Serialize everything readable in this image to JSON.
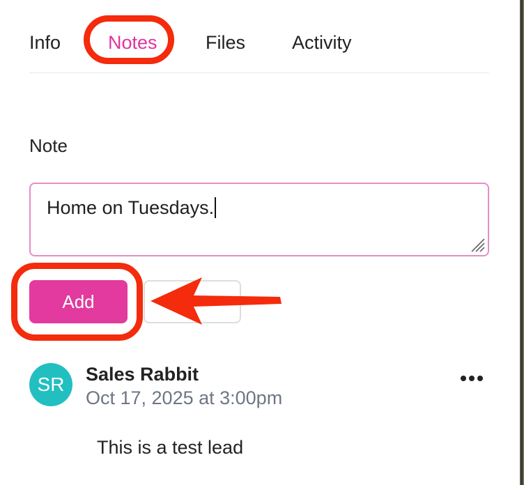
{
  "tabs": [
    {
      "label": "Info"
    },
    {
      "label": "Notes",
      "active": true
    },
    {
      "label": "Files"
    },
    {
      "label": "Activity"
    }
  ],
  "note_form": {
    "label": "Note",
    "value": "Home on Tuesdays.",
    "add_label": "Add",
    "cancel_label": ""
  },
  "note_entry": {
    "avatar_initials": "SR",
    "author": "Sales Rabbit",
    "timestamp": "Oct 17, 2025 at 3:00pm",
    "body": "This is a test lead"
  },
  "colors": {
    "accent": "#e23a9e",
    "active_tab": "#e1349c",
    "avatar": "#22bfc1",
    "annotation": "#f42b0c",
    "timestamp": "#6e7684"
  },
  "icons": {
    "more": "more-horizontal-icon",
    "resize": "resize-grip-icon"
  }
}
